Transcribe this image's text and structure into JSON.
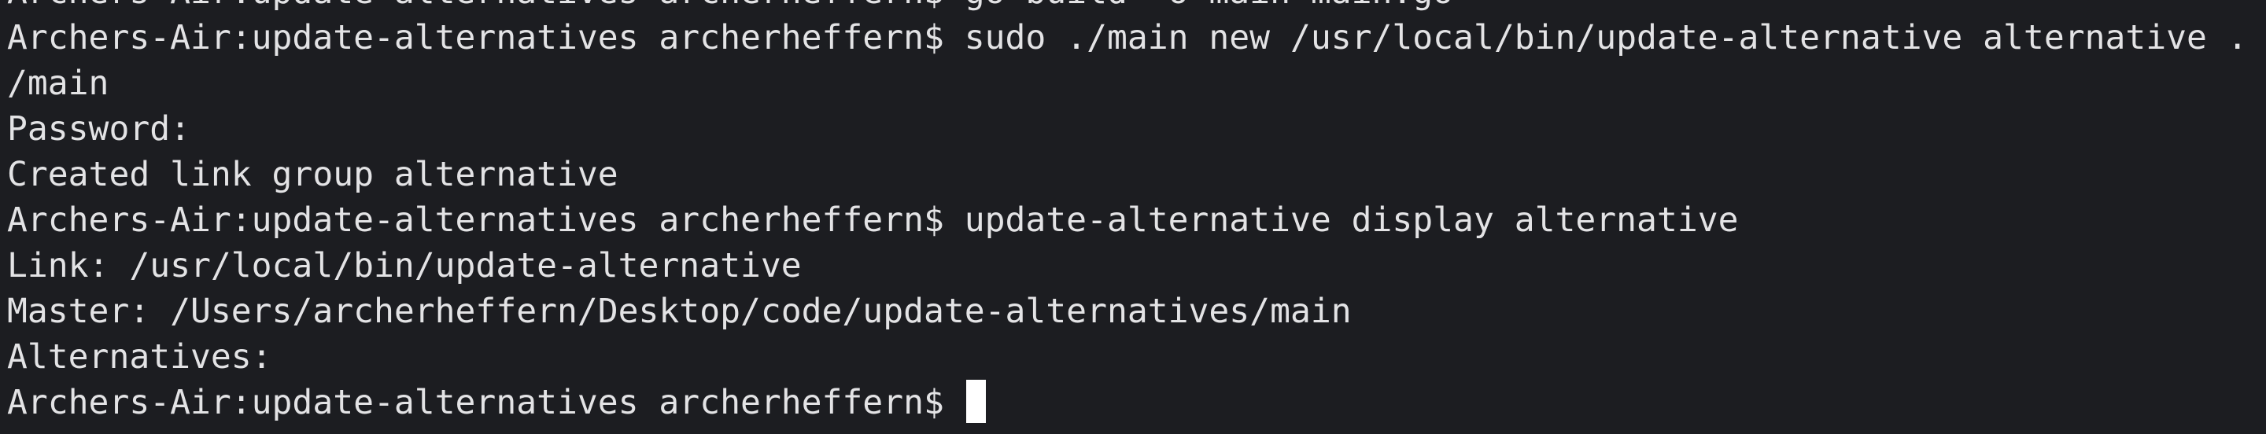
{
  "terminal": {
    "lines": [
      "Archers-Air:update-alternatives archerheffern$ go build -o main main.go",
      "Archers-Air:update-alternatives archerheffern$ sudo ./main new /usr/local/bin/update-alternative alternative .",
      "/main",
      "Password:",
      "Created link group alternative",
      "Archers-Air:update-alternatives archerheffern$ update-alternative display alternative",
      "Link: /usr/local/bin/update-alternative",
      "Master: /Users/archerheffern/Desktop/code/update-alternatives/main",
      "Alternatives:",
      "Archers-Air:update-alternatives archerheffern$ "
    ]
  }
}
